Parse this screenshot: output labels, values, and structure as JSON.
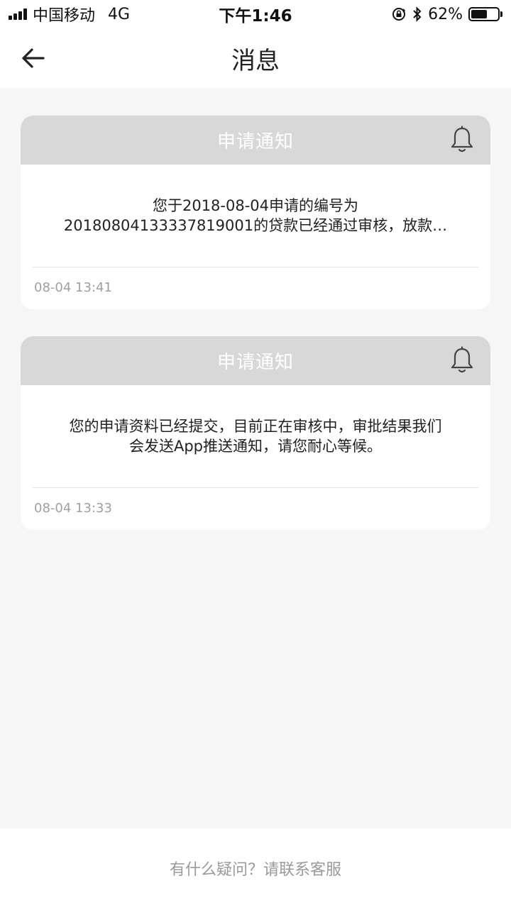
{
  "status_bar": {
    "carrier": "中国移动",
    "network": "4G",
    "time": "下午1:46",
    "battery_percent": "62%",
    "battery_level": 0.62
  },
  "nav": {
    "title": "消息"
  },
  "messages": [
    {
      "title": "申请通知",
      "body_line1": "您于2018-08-04申请的编号为",
      "body_line2": "2018080413333781 9001的贷款已经通过审核，放款…",
      "time": "08-04 13:41"
    },
    {
      "title": "申请通知",
      "body_line1": "您的申请资料已经提交，目前正在审核中，审批结果我们",
      "body_line2": "会发送App推送通知，请您耐心等候。",
      "time": "08-04 13:33"
    }
  ],
  "footer": {
    "help_text": "有什么疑问？请联系客服"
  },
  "colors": {
    "card_header": "#d8d8d8",
    "background": "#f6f6f6"
  },
  "icons": {
    "back": "arrow-left-icon",
    "bell": "bell-icon",
    "signal": "signal-icon",
    "lock_rotation": "rotation-lock-icon",
    "bluetooth": "bluetooth-icon",
    "battery": "battery-icon"
  }
}
